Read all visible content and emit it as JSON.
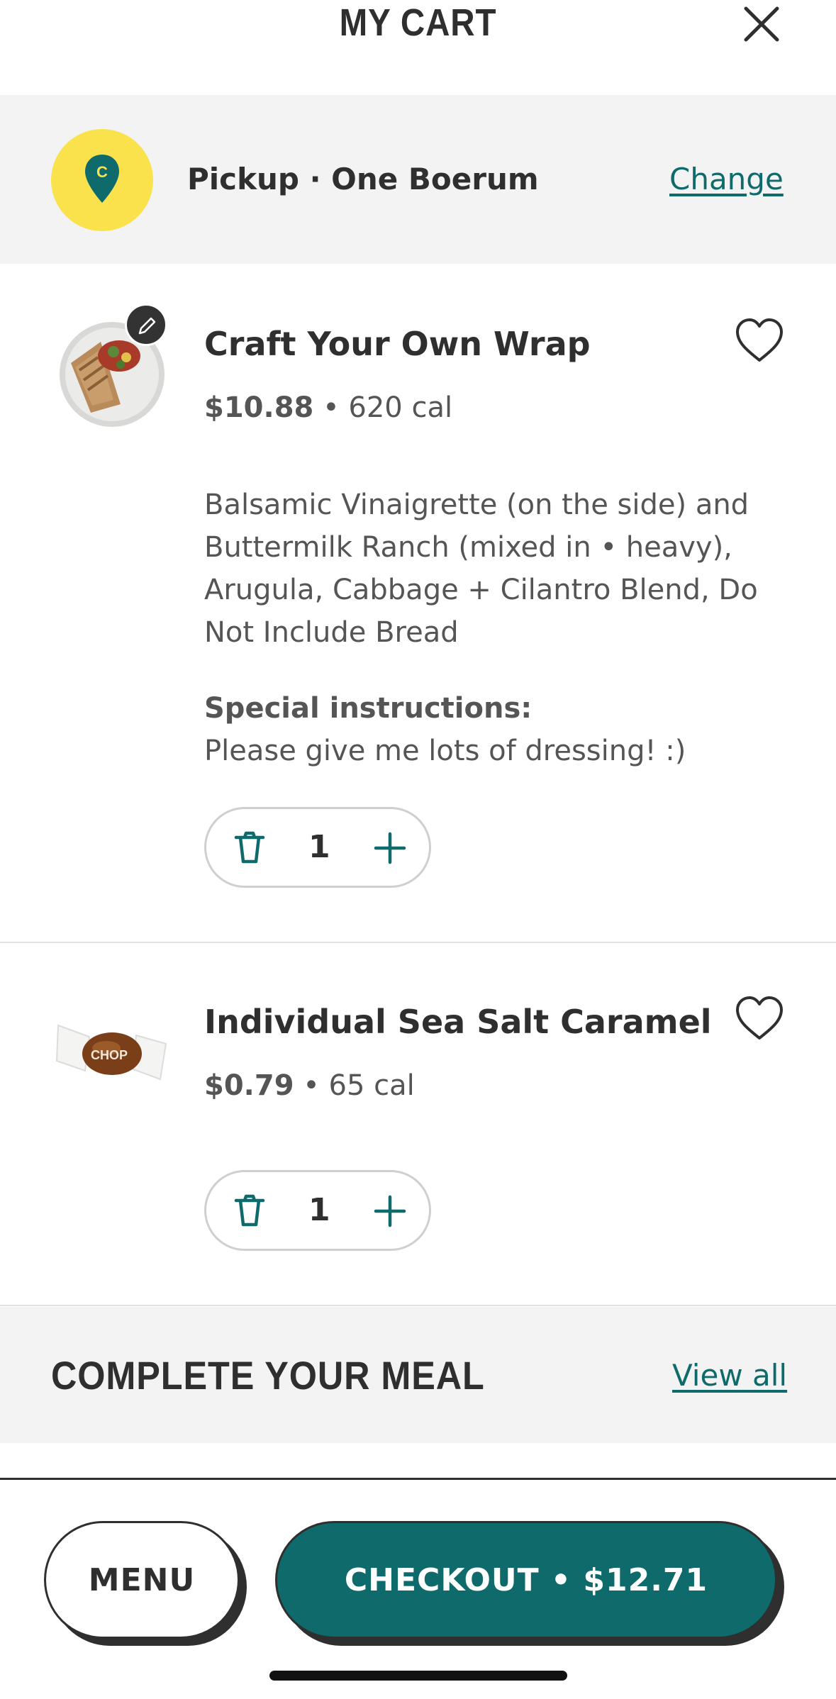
{
  "header": {
    "title": "MY CART",
    "close_icon": "close-icon"
  },
  "pickup": {
    "method_location": "Pickup · One Boerum",
    "change_label": "Change",
    "pin_letter": "C",
    "pin_icon": "location-pin-icon",
    "accent": "#f9e24b",
    "brand": "#0f6a6b"
  },
  "items": [
    {
      "name": "Craft Your Own Wrap",
      "price": "$10.88",
      "calories": "• 620 cal",
      "image": "wrap-image",
      "description": "Balsamic Vinaigrette (on the side) and Buttermilk Ranch (mixed in • heavy), Arugula, Cabbage + Cilantro Blend, Do Not Include Bread",
      "special_label": "Special instructions:",
      "special_text": "Please give me lots of dressing! :)",
      "quantity": "1"
    },
    {
      "name": "Individual Sea Salt Caramel",
      "price": "$0.79",
      "calories": "• 65 cal",
      "image": "caramel-image",
      "image_text": "CHOP",
      "quantity": "1"
    }
  ],
  "upsell": {
    "title": "COMPLETE YOUR MEAL",
    "view_all_label": "View all"
  },
  "footer": {
    "menu_label": "MENU",
    "checkout_label": "CHECKOUT • $12.71"
  }
}
